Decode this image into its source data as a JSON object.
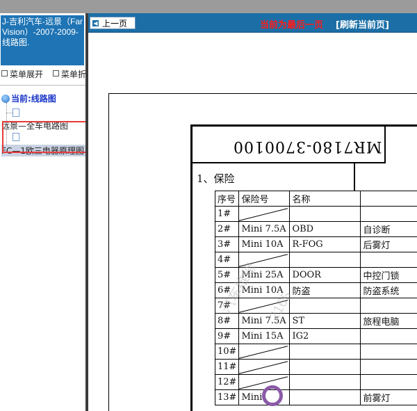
{
  "left": {
    "doc_title": "J-吉利汽车-远景（Far Vision）-2007-2009- 线路图.",
    "menu": {
      "expand": "菜单展开",
      "collapse": "菜单折"
    },
    "tree": {
      "root": "当前:线路图",
      "items": [
        "远景—全车电路图",
        "FC—1欧三电器原理图"
      ]
    }
  },
  "nav": {
    "prev": "上一页",
    "last_page_notice": "当前为最后一页",
    "refresh": "[刷新当前页]"
  },
  "doc": {
    "code": "MR7180-3700100",
    "section_title": "1、保险",
    "headers": [
      "序号",
      "保险号",
      "名称",
      ""
    ],
    "rows": [
      [
        "1#",
        "",
        "",
        ""
      ],
      [
        "2#",
        "Mini  7.5A",
        "OBD",
        "自诊断"
      ],
      [
        "3#",
        "Mini  10A",
        "R-FOG",
        "后雾灯"
      ],
      [
        "4#",
        "",
        "",
        ""
      ],
      [
        "5#",
        "Mini  25A",
        "DOOR",
        "中控门锁"
      ],
      [
        "6#",
        "Mini  10A",
        "防盗",
        "防盗系统"
      ],
      [
        "7#",
        "",
        "",
        ""
      ],
      [
        "8#",
        "Mini  7.5A",
        "ST",
        "旅程电脑"
      ],
      [
        "9#",
        "Mini  15A",
        "IG2",
        ""
      ],
      [
        "10#",
        "",
        "",
        ""
      ],
      [
        "11#",
        "",
        "",
        ""
      ],
      [
        "12#",
        "",
        "",
        ""
      ],
      [
        "13#",
        "Mini",
        "",
        "前雾灯"
      ]
    ]
  },
  "colors": {
    "nav_bar": "#1b6fa6",
    "title_bg": "#1e74b4",
    "notice_red": "#ff1b1b",
    "selection_outline": "#e63a3a"
  }
}
